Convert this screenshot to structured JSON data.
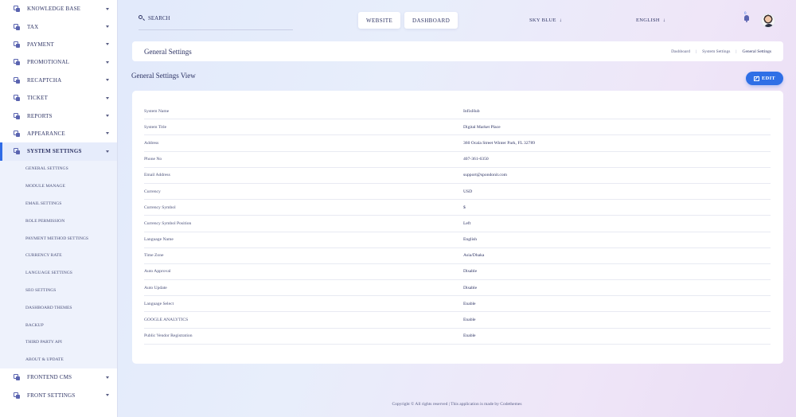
{
  "sidebar": {
    "items_top": [
      {
        "label": "KNOWLEDGE BASE"
      },
      {
        "label": "TAX"
      },
      {
        "label": "PAYMENT"
      },
      {
        "label": "PROMOTIONAL"
      },
      {
        "label": "RECAPTCHA"
      },
      {
        "label": "TICKET"
      },
      {
        "label": "REPORTS"
      },
      {
        "label": "APPEARANCE"
      },
      {
        "label": "SYSTEM SETTINGS"
      }
    ],
    "submenu": [
      "GENERAL SETTINGS",
      "MODULE MANAGE",
      "EMAIL SETTINGS",
      "ROLE PERMISSION",
      "PAYMENT METHOD SETTINGS",
      "CURRENCY RATE",
      "LANGUAGE SETTINGS",
      "SEO SETTINGS",
      "DASHBOARD THEMES",
      "BACKUP",
      "THIRD PARTY API",
      "ABOUT & UPDATE"
    ],
    "items_bottom": [
      {
        "label": "FRONTEND CMS"
      },
      {
        "label": "FRONT SETTINGS"
      }
    ]
  },
  "topbar": {
    "search_placeholder": "SEARCH",
    "website_label": "WEBSITE",
    "dashboard_label": "DASHBOARD",
    "theme_label": "SKY BLUE",
    "language_label": "ENGLISH",
    "notification_count": "0"
  },
  "header": {
    "title": "General Settings",
    "breadcrumb": [
      "Dashboard",
      "System Settings",
      "General Settings"
    ]
  },
  "section": {
    "title": "General Settings View",
    "edit_label": "EDIT"
  },
  "settings": [
    {
      "key": "System Name",
      "value": "InfixHub"
    },
    {
      "key": "System Title",
      "value": "Digital Market Place"
    },
    {
      "key": "Address",
      "value": "360 Ocala Street Winter Park, FL 32789"
    },
    {
      "key": "Phone No",
      "value": "407-361-6350"
    },
    {
      "key": "Email Address",
      "value": "support@spondonit.com"
    },
    {
      "key": "Currency",
      "value": "USD"
    },
    {
      "key": "Currency Symbol",
      "value": "$"
    },
    {
      "key": "Currency Symbol Position",
      "value": "Left"
    },
    {
      "key": "Language Name",
      "value": "English"
    },
    {
      "key": "Time Zone",
      "value": "Asia/Dhaka"
    },
    {
      "key": "Auto Approval",
      "value": "Disable"
    },
    {
      "key": "Auto Update",
      "value": "Disable"
    },
    {
      "key": "Language Select",
      "value": "Enable"
    },
    {
      "key": "GOOGLE ANALYTICS",
      "value": "Enable"
    },
    {
      "key": "Public Vendor Registration",
      "value": "Enable"
    }
  ],
  "footer": {
    "text": "Copyright © All rights reserved | This application is made by Codethemes"
  },
  "colors": {
    "accent": "#2f6fe6",
    "text": "#2d3364",
    "sidebar_active_bg": "#e6ecfb"
  }
}
